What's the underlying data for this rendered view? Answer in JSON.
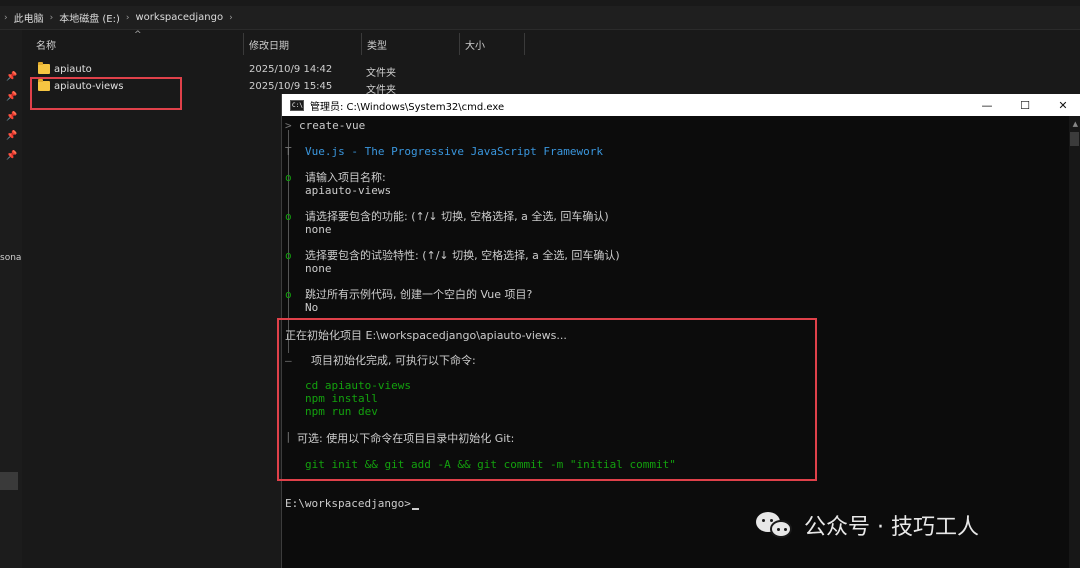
{
  "breadcrumb": [
    "此电脑",
    "本地磁盘 (E:)",
    "workspacedjango"
  ],
  "columns": {
    "name": "名称",
    "date": "修改日期",
    "type": "类型",
    "size": "大小"
  },
  "nav_partial_text": "sona",
  "files": [
    {
      "name": "apiauto",
      "date": "2025/10/9 14:42",
      "type": "文件夹"
    },
    {
      "name": "apiauto-views",
      "date": "2025/10/9 15:45",
      "type": "文件夹"
    }
  ],
  "cmd": {
    "title": "管理员: C:\\Windows\\System32\\cmd.exe",
    "icon_text": "C:\\.",
    "win_minimize": "—",
    "win_maximize": "☐",
    "win_close": "✕",
    "lines": {
      "l1_prefix": ">",
      "l1": "create-vue",
      "gutter_t": "T",
      "l2": "Vue.js - The Progressive JavaScript Framework",
      "gutter_o": "o",
      "q1": "请输入项目名称:",
      "a1": "apiauto-views",
      "q2": "请选择要包含的功能: (↑/↓ 切换, 空格选择, a 全选, 回车确认)",
      "a2": "none",
      "q3": "选择要包含的试验特性: (↑/↓ 切换, 空格选择, a 全选, 回车确认)",
      "a3": "none",
      "q4": "跳过所有示例代码, 创建一个空白的 Vue 项目?",
      "a4": "No",
      "init": "正在初始化项目 E:\\workspacedjango\\apiauto-views...",
      "done_prefix": "—",
      "done": "项目初始化完成, 可执行以下命令:",
      "cmd1": "cd apiauto-views",
      "cmd2": "npm install",
      "cmd3": "npm run dev",
      "opt_prefix": "|",
      "opt": "可选: 使用以下命令在项目目录中初始化 Git:",
      "git": "git init && git add -A && git commit -m \"initial commit\"",
      "prompt": "E:\\workspacedjango>"
    }
  },
  "watermark": "公众号 · 技巧工人",
  "colors": {
    "highlight": "#e0414a",
    "term_green": "#13a10e",
    "term_cyan": "#3a96dd",
    "folder": "#f5c542"
  }
}
